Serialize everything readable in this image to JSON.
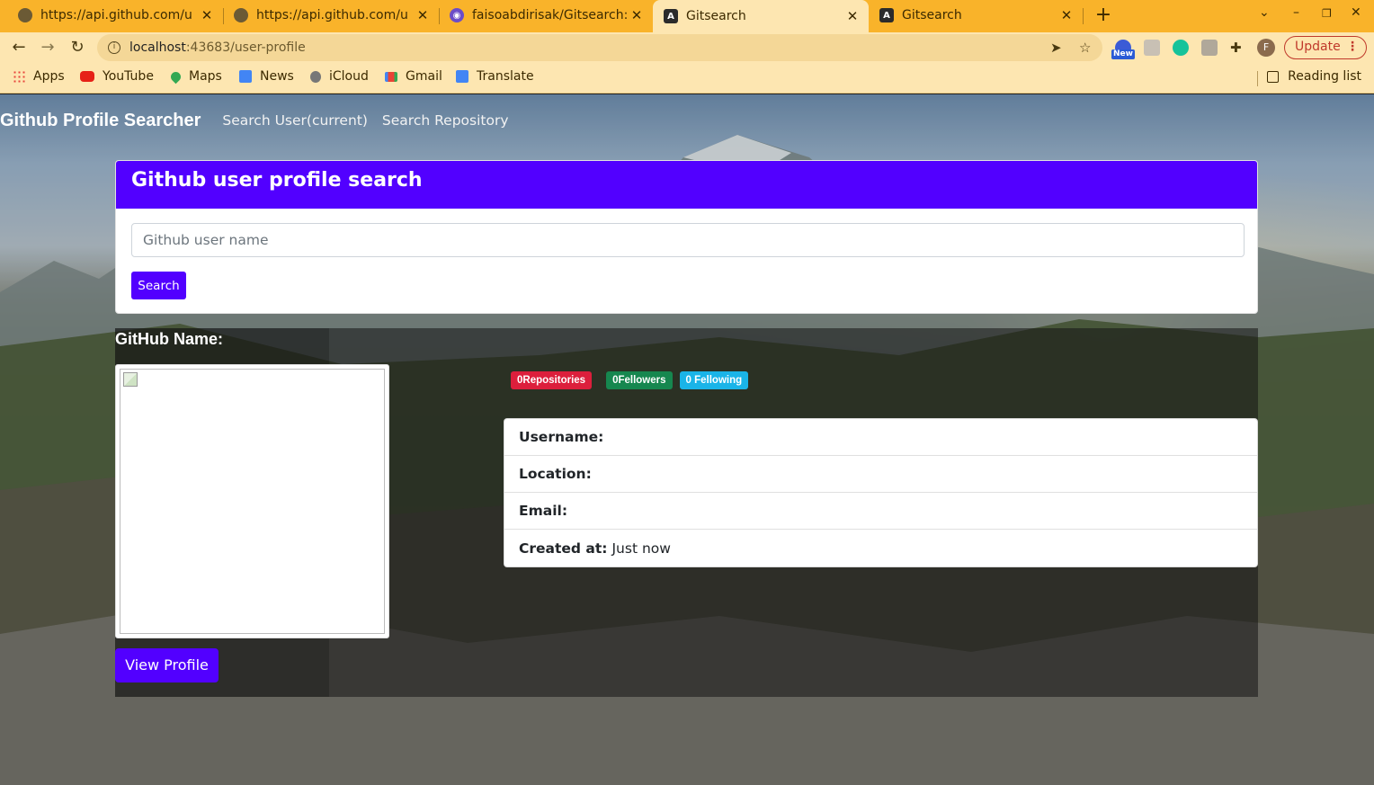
{
  "browser": {
    "tabs": [
      {
        "title": "https://api.github.com/u",
        "icon": "globe-icon"
      },
      {
        "title": "https://api.github.com/u",
        "icon": "globe-icon"
      },
      {
        "title": "faisoabdirisak/Gitsearch:",
        "icon": "github-icon"
      },
      {
        "title": "Gitsearch",
        "icon": "angular-icon",
        "active": true
      },
      {
        "title": "Gitsearch",
        "icon": "angular-icon"
      }
    ],
    "url_host": "localhost",
    "url_path": ":43683/user-profile",
    "profile_initial": "F",
    "update_label": "Update",
    "new_badge": "New",
    "bookmarks": [
      {
        "label": "Apps",
        "color": "#e8453c"
      },
      {
        "label": "YouTube",
        "color": "#e62117"
      },
      {
        "label": "Maps",
        "color": "#34a853"
      },
      {
        "label": "News",
        "color": "#4285f4"
      },
      {
        "label": "iCloud",
        "color": "#777777"
      },
      {
        "label": "Gmail",
        "color": "#ea4335"
      },
      {
        "label": "Translate",
        "color": "#4285f4"
      }
    ],
    "reading_list": "Reading list"
  },
  "nav": {
    "brand": "Github Profile Searcher",
    "links": [
      "Search User(current)",
      "Search Repository"
    ]
  },
  "search": {
    "header": "Github user profile search",
    "placeholder": "Github user name",
    "button": "Search"
  },
  "profile": {
    "name_label": "GitHub Name:",
    "view_profile": "View Profile",
    "badges": {
      "repositories": "0Repositories",
      "followers": "0Fellowers",
      "following": "0 Fellowing"
    },
    "details": [
      {
        "key": "Username:",
        "value": ""
      },
      {
        "key": "Location:",
        "value": ""
      },
      {
        "key": "Email:",
        "value": ""
      },
      {
        "key": "Created at:",
        "value": "Just now"
      }
    ]
  },
  "colors": {
    "brand_purple": "#5200ff",
    "badge_red": "#dc1f3c",
    "badge_green": "#16874f",
    "badge_cyan": "#1ab4e8",
    "chrome_tabbar": "#f9b32a"
  }
}
